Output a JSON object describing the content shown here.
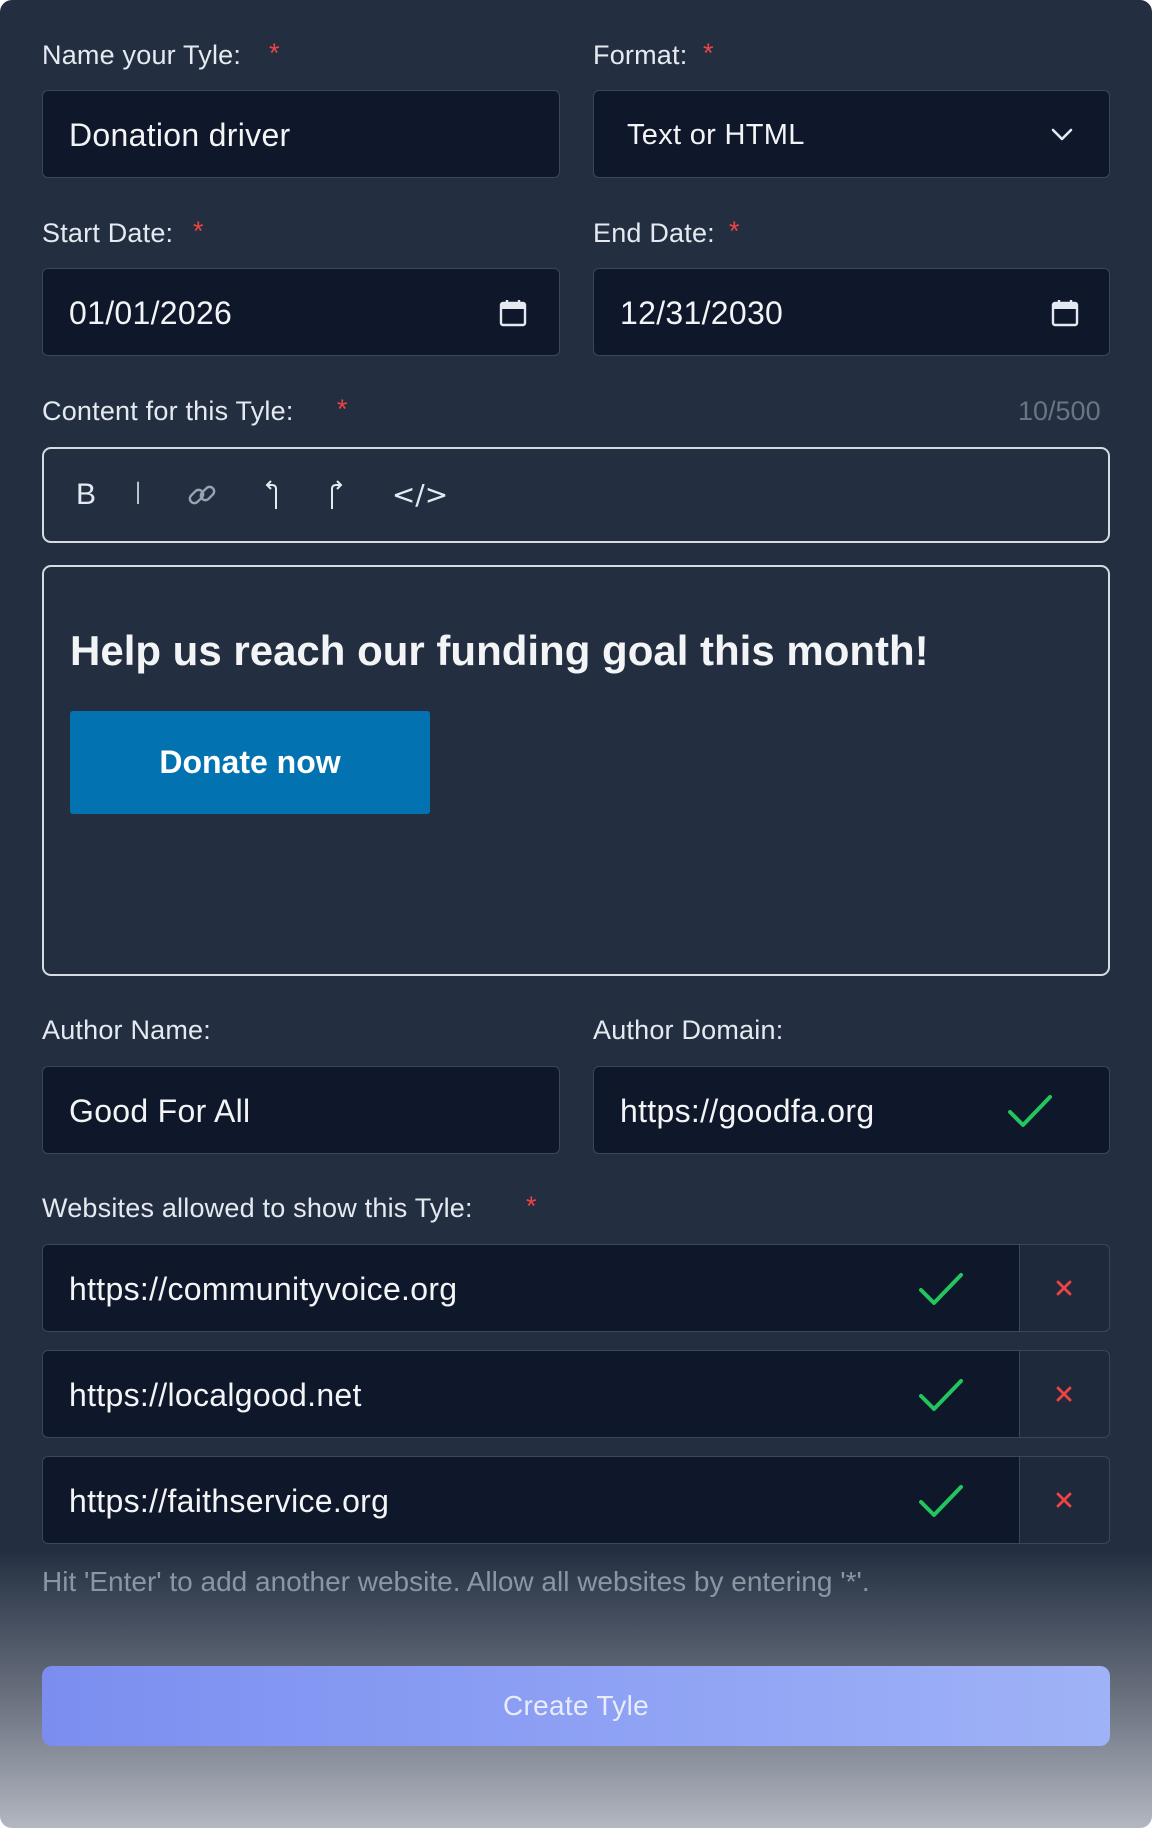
{
  "form": {
    "name": {
      "label": "Name your Tyle:",
      "required": "*",
      "value": "Donation driver"
    },
    "format": {
      "label": "Format:",
      "required": "*",
      "value": "Text or HTML",
      "icon": "chevron-down-icon"
    },
    "start_date": {
      "label": "Start Date:",
      "required": "*",
      "value": "01/01/2026",
      "icon": "calendar-icon"
    },
    "end_date": {
      "label": "End Date:",
      "required": "*",
      "value": "12/31/2030",
      "icon": "calendar-icon"
    },
    "content": {
      "label": "Content for this Tyle:",
      "required": "*",
      "counter": "10/500",
      "toolbar": {
        "bold": "B",
        "italic": "I",
        "link_icon": "link-icon",
        "undo_icon": "undo-icon",
        "redo_icon": "redo-icon",
        "code": "</>"
      },
      "preview_heading": "Help us reach our funding goal this month!",
      "preview_button": "Donate now",
      "preview_button_color": "#0273b0"
    },
    "author_name": {
      "label": "Author Name:",
      "value": "Good For All"
    },
    "author_domain": {
      "label": "Author Domain:",
      "value": "https://goodfa.org",
      "status_icon": "check-icon"
    },
    "websites": {
      "label": "Websites allowed to show this Tyle:",
      "required": "*",
      "items": [
        {
          "url": "https://communityvoice.org",
          "status_icon": "check-icon",
          "remove_icon": "close-icon"
        },
        {
          "url": "https://localgood.net",
          "status_icon": "check-icon",
          "remove_icon": "close-icon"
        },
        {
          "url": "https://faithservice.org",
          "status_icon": "check-icon",
          "remove_icon": "close-icon"
        }
      ],
      "hint": "Hit 'Enter' to add another website. Allow all websites by entering '*'."
    },
    "submit_label": "Create Tyle"
  },
  "colors": {
    "background": "#232f41",
    "input_bg": "#0f172a",
    "required": "#ef4444",
    "check": "#22c55e",
    "remove": "#ef4444",
    "submit_from": "#7b8ef0",
    "submit_to": "#9fb2f7"
  }
}
